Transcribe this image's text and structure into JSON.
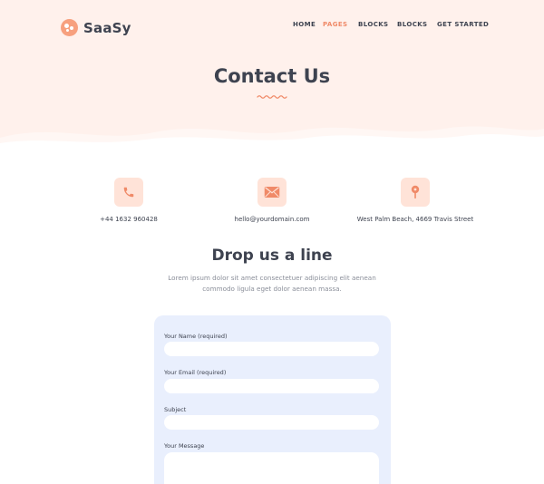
{
  "brand": {
    "name": "SaaSy",
    "accent": "#f08a68",
    "hero_bg": "#fff1ec",
    "form_bg": "#e9effd"
  },
  "nav": {
    "items": [
      {
        "label": "HOME",
        "active": false
      },
      {
        "label": "PAGES",
        "active": true
      },
      {
        "label": "BLOCKS",
        "active": false
      },
      {
        "label": "BLOCKS",
        "active": false
      },
      {
        "label": "GET STARTED",
        "active": false
      }
    ]
  },
  "hero": {
    "title": "Contact Us"
  },
  "contact_info": [
    {
      "icon": "phone-icon",
      "text": "+44 1632 960428"
    },
    {
      "icon": "mail-icon",
      "text": "hello@yourdomain.com"
    },
    {
      "icon": "map-pin-icon",
      "text": "West Palm Beach, 4669 Travis Street"
    }
  ],
  "section": {
    "title": "Drop us a line",
    "description_line1": "Lorem ipsum dolor sit amet consectetuer adipiscing elit aenean",
    "description_line2": "commodo ligula eget dolor aenean massa."
  },
  "form": {
    "name_label": "Your Name (required)",
    "name_value": "",
    "email_label": "Your Email (required)",
    "email_value": "",
    "subject_label": "Subject",
    "subject_value": "",
    "message_label": "Your Message",
    "message_value": ""
  }
}
